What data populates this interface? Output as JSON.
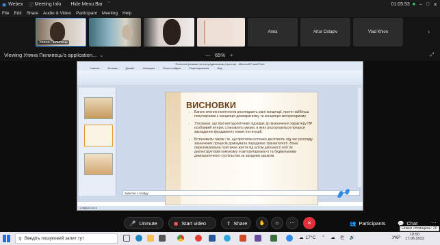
{
  "titlebar": {
    "app": "Webex",
    "meeting_info": "Meeting Info",
    "hide_menu": "Hide Menu Bar",
    "timer": "01:05:53"
  },
  "menu": [
    "File",
    "Edit",
    "Share",
    "Audio & Video",
    "Participant",
    "Meeting",
    "Help"
  ],
  "participants": {
    "video_tiles": [
      {
        "name": "Уляна Пилипець"
      }
    ],
    "name_tiles": [
      "Anna",
      "Artur Ostapiv",
      "Vlad Khlon"
    ]
  },
  "sharebar": {
    "viewing": "Viewing Уляна Пилипець's application...",
    "zoom": "65%"
  },
  "ppt": {
    "window_title": "Політичні режими на пострадянському просторі - Microsoft PowerPoint",
    "tabs": [
      "Главная",
      "Вставка",
      "Дизайн",
      "Анимация",
      "Показ слайдов",
      "Рецензирование",
      "Вид"
    ],
    "status": "Слайд 10 из 14",
    "notes_placeholder": "Заметки к слайду",
    "slide": {
      "heading": "ВИСНОВКИ",
      "bullets": [
        "Багато вчених-політологів розглядають різні концепції, проте найбільш популярними є концепція демократизму та концепція авторитаризму.",
        "З'ясовано, що при методологічних підходах до визначення характеру ПР особливий інтерес становлять умови, в яких розгортаються процеси закладення фундаменту нових інституцій.",
        "Встановили також і те, що протягом останніх десятиліть під час розгляду зазначених процесів домінувала парадигма транзитології. Вона переломлювала політичне життя під кутом діяльності еліт як деконструкторів комунізму («авторитаризму») та будівельників демократичного суспільства за західним зразком."
      ]
    }
  },
  "controls": {
    "unmute": "Unmute",
    "start_video": "Start video",
    "share": "Share",
    "participants": "Participants",
    "chat": "Chat",
    "end_color": "#e0303a"
  },
  "taskbar": {
    "search_placeholder": "Введіть пошуковий запит тут",
    "temp": "17°C",
    "lang": "УКР",
    "time": "10:50",
    "date": "17.06.2022",
    "notification": "Нових сповіщень: 20"
  }
}
